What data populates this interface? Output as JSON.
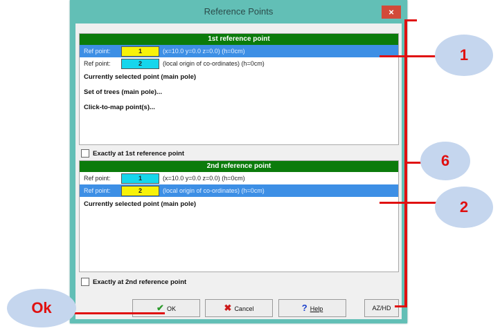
{
  "dialog": {
    "title": "Reference Points",
    "close_label": "×"
  },
  "panel1": {
    "header": "1st reference point",
    "rows": [
      {
        "label": "Ref point:",
        "num": "1",
        "desc": "(x=10.0  y=0.0  z=0.0)  (h=0cm)"
      },
      {
        "label": "Ref point:",
        "num": "2",
        "desc": "(local origin of co-ordinates)  (h=0cm)"
      }
    ],
    "items": [
      "Currently selected point (main pole)",
      "Set of trees (main pole)...",
      "Click-to-map point(s)..."
    ],
    "checkbox_label": "Exactly at 1st reference point"
  },
  "panel2": {
    "header": "2nd reference point",
    "rows": [
      {
        "label": "Ref point:",
        "num": "1",
        "desc": "(x=10.0  y=0.0  z=0.0)  (h=0cm)"
      },
      {
        "label": "Ref point:",
        "num": "2",
        "desc": "(local origin of co-ordinates)  (h=0cm)"
      }
    ],
    "items": [
      "Currently selected point (main pole)"
    ],
    "checkbox_label": "Exactly at 2nd reference point"
  },
  "buttons": {
    "ok": "OK",
    "cancel": "Cancel",
    "help": "Help",
    "azhd": "AZ/HD"
  },
  "callouts": {
    "c1": "1",
    "c6": "6",
    "c2": "2",
    "ok": "Ok"
  },
  "colors": {
    "callout_bg": "#c5d6ee",
    "callout_text": "#e01010",
    "header_green": "#0b7b0b",
    "selection_blue": "#3d8fe5",
    "swatch_yellow": "#f7f209",
    "swatch_cyan": "#16d6ec"
  }
}
